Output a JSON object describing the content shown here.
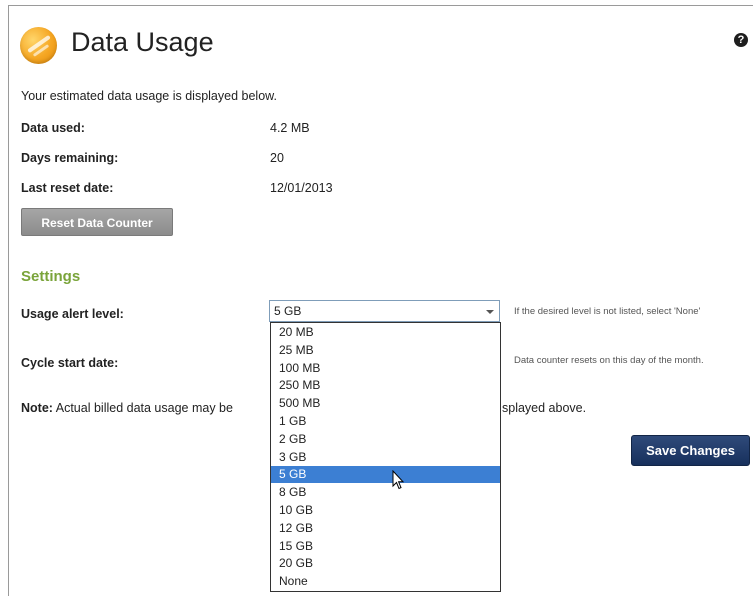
{
  "page": {
    "title": "Data Usage",
    "help_symbol": "?"
  },
  "intro": "Your estimated data usage is displayed below.",
  "stats": [
    {
      "label": "Data used:",
      "value": "4.2 MB"
    },
    {
      "label": "Days remaining:",
      "value": "20"
    },
    {
      "label": "Last reset date:",
      "value": "12/01/2013"
    }
  ],
  "reset_button": "Reset Data Counter",
  "settings": {
    "heading": "Settings",
    "alert_label": "Usage alert level:",
    "alert_selected": "5 GB",
    "alert_hint": "If the desired level is not listed, select 'None'",
    "cycle_label": "Cycle start date:",
    "cycle_hint": "Data counter resets on this day of the month.",
    "note_bold": "Note:",
    "note_text": "Actual billed data usage may be",
    "note_tail": "splayed above."
  },
  "save_button": "Save Changes",
  "dropdown_options": [
    "20 MB",
    "25 MB",
    "100 MB",
    "250 MB",
    "500 MB",
    "1 GB",
    "2 GB",
    "3 GB",
    "5 GB",
    "8 GB",
    "10 GB",
    "12 GB",
    "15 GB",
    "20 GB",
    "None"
  ],
  "colors": {
    "accent_green": "#7aa43a",
    "save_blue": "#17305c",
    "selection_blue": "#3c7fd3"
  }
}
